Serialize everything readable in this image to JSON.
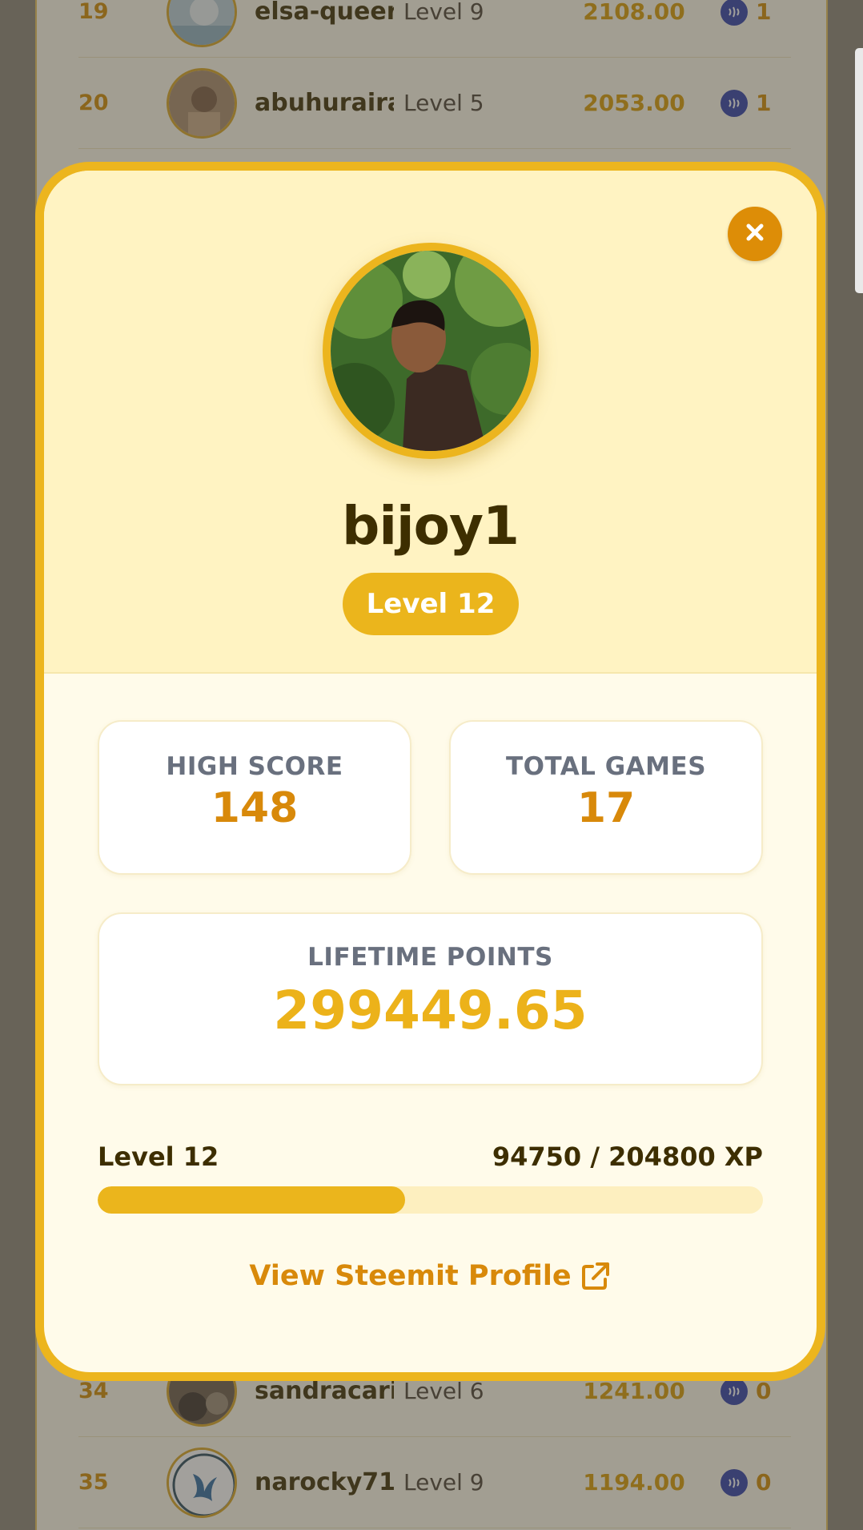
{
  "leaderboard": {
    "rows": [
      {
        "rank": "19",
        "name": "elsa-queer",
        "level": "Level 9",
        "points": "2108.00",
        "count": "1"
      },
      {
        "rank": "20",
        "name": "abuhuraira",
        "level": "Level 5",
        "points": "2053.00",
        "count": "1"
      },
      {
        "rank": "34",
        "name": "sandracari",
        "level": "Level 6",
        "points": "1241.00",
        "count": "0"
      },
      {
        "rank": "35",
        "name": "narocky71",
        "level": "Level 9",
        "points": "1194.00",
        "count": "0"
      }
    ]
  },
  "profile": {
    "username": "bijoy1",
    "level_badge": "Level 12",
    "close_icon": "close-icon"
  },
  "stats": {
    "high_score_label": "HIGH SCORE",
    "high_score_value": "148",
    "total_games_label": "TOTAL GAMES",
    "total_games_value": "17",
    "lifetime_label": "LIFETIME POINTS",
    "lifetime_value": "299449.65"
  },
  "xp": {
    "level_label": "Level 12",
    "progress_text": "94750 / 204800 XP",
    "current": 94750,
    "max": 204800
  },
  "links": {
    "steemit_label": "View Steemit Profile",
    "steemit_icon": "external-link-icon"
  },
  "colors": {
    "accent": "#ecb51e",
    "accent_dark": "#dd8d07",
    "text_dark": "#3d2e00",
    "label_gray": "#69707e"
  }
}
